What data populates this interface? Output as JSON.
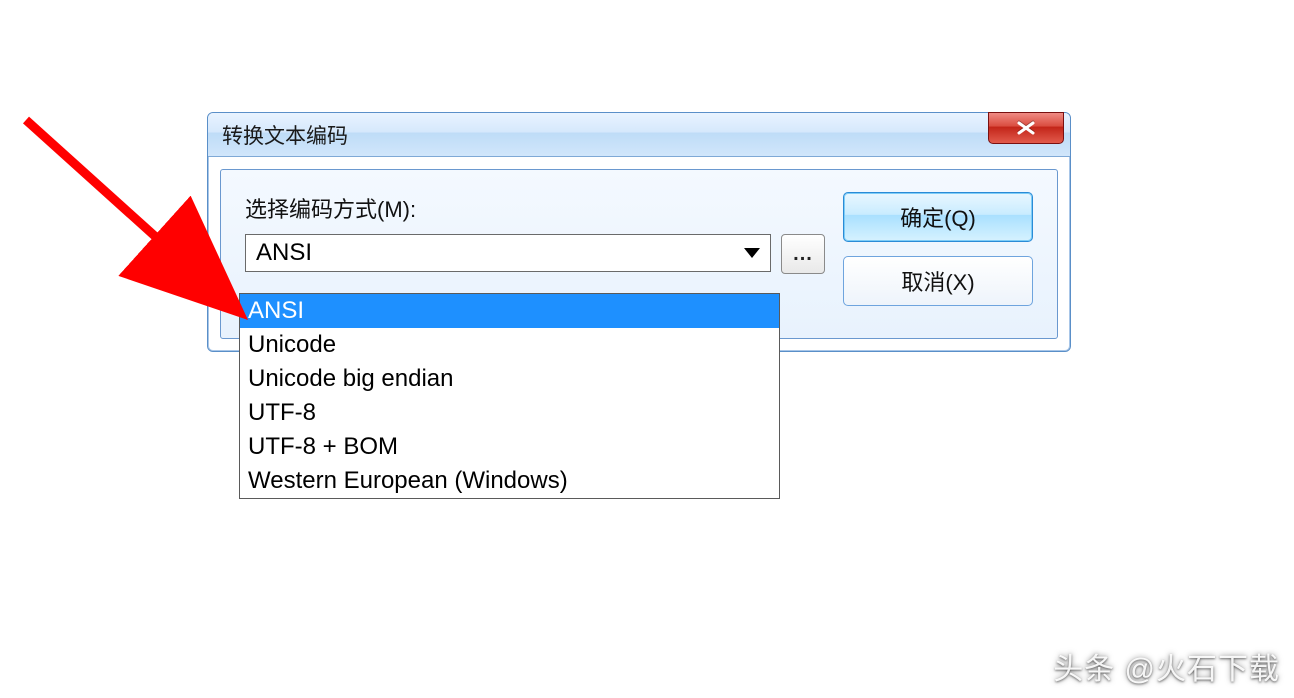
{
  "dialog": {
    "title": "转换文本编码",
    "field_label": "选择编码方式(M):",
    "combo_value": "ANSI",
    "more_label": "...",
    "ok_label": "确定(Q)",
    "cancel_label": "取消(X)"
  },
  "dropdown": {
    "selected_index": 0,
    "options": [
      "ANSI",
      "Unicode",
      "Unicode big endian",
      "UTF-8",
      "UTF-8 + BOM",
      "Western European (Windows)"
    ]
  },
  "watermark": "头条 @火石下载",
  "colors": {
    "accent_blue": "#1e90ff",
    "close_red": "#d94b3e"
  }
}
